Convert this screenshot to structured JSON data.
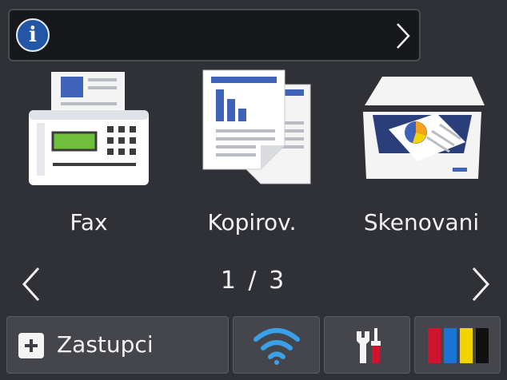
{
  "info_bar": {
    "icon": "info-icon",
    "chevron": "chevron-right-icon"
  },
  "apps": [
    {
      "label": "Fax",
      "icon": "fax-machine-icon"
    },
    {
      "label": "Kopirov.",
      "icon": "copy-documents-icon"
    },
    {
      "label": "Skenovani",
      "icon": "scanner-icon"
    }
  ],
  "pager": {
    "indicator": "1 / 3",
    "prev_icon": "chevron-left-icon",
    "next_icon": "chevron-right-icon"
  },
  "bottom_bar": {
    "shortcuts_label": "Zastupci",
    "shortcuts_icon": "plus-icon",
    "wifi_icon": "wifi-icon",
    "settings_icon": "wrench-screwdriver-icon",
    "ink_icon": "ink-cartridges-icon"
  },
  "colors": {
    "background": "#2f3136",
    "info_blue": "#2456a6",
    "wifi_blue": "#3aa0e8",
    "ink": [
      "#d0132e",
      "#1a73d6",
      "#f2d400",
      "#111111"
    ]
  }
}
